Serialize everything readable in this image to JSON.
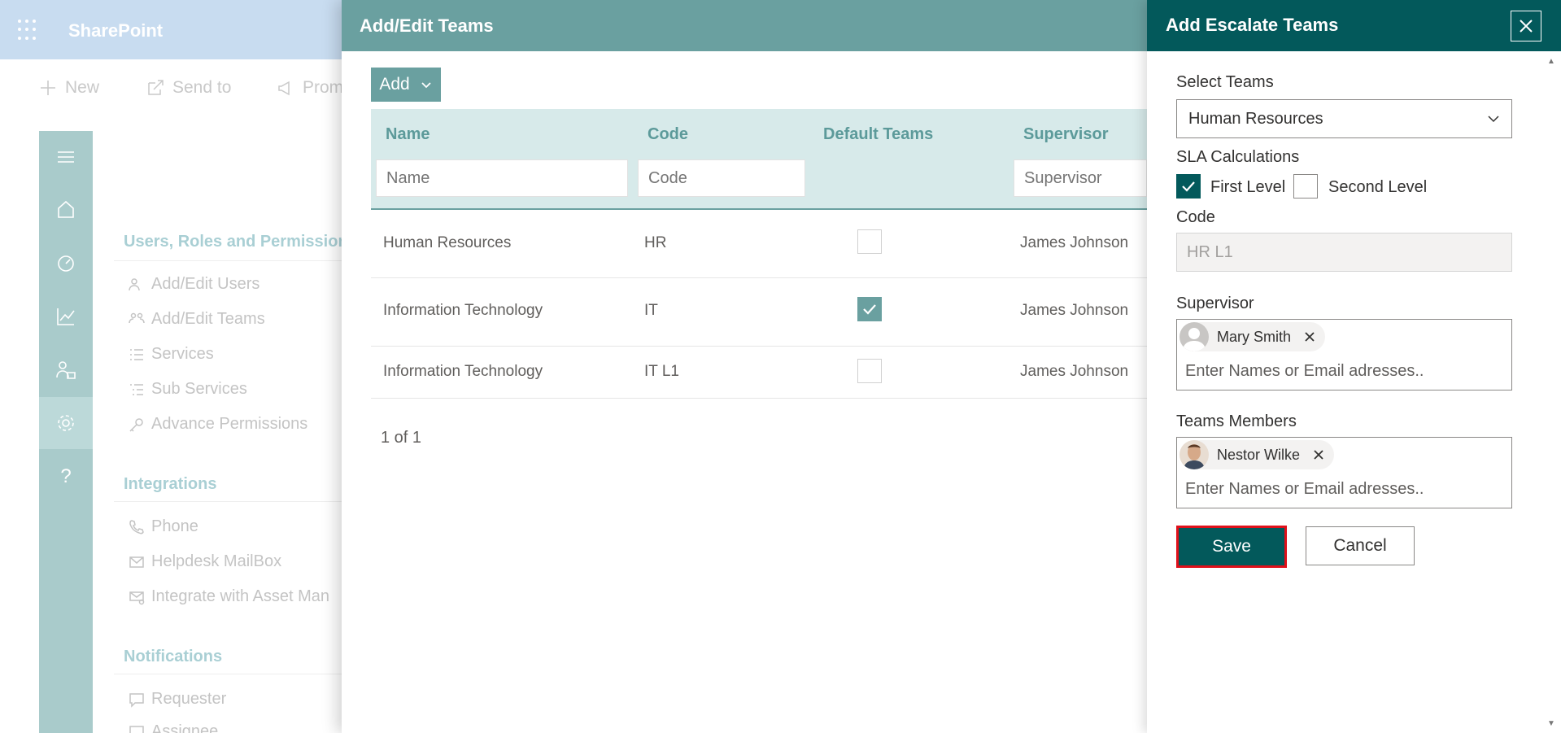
{
  "sharepoint": {
    "brand": "SharePoint",
    "commands": [
      {
        "label": "New",
        "icon": "plus-icon"
      },
      {
        "label": "Send to",
        "icon": "share-icon"
      },
      {
        "label": "Prom",
        "icon": "megaphone-icon"
      }
    ],
    "rail_icons": [
      "menu-icon",
      "home-icon",
      "dashboard-icon",
      "chart-icon",
      "people-icon",
      "gear-icon",
      "help-icon"
    ],
    "rail_help": "?",
    "nav": {
      "users_heading": "Users, Roles and Permissions",
      "users_items": [
        "Add/Edit Users",
        "Add/Edit Teams",
        "Services",
        "Sub Services",
        "Advance Permissions"
      ],
      "integrations_heading": "Integrations",
      "integrations_items": [
        "Phone",
        "Helpdesk MailBox",
        "Integrate with Asset Man"
      ],
      "notifications_heading": "Notifications",
      "notifications_items": [
        "Requester",
        "Assignee"
      ]
    }
  },
  "teams_panel": {
    "title": "Add/Edit Teams",
    "add_label": "Add",
    "columns": [
      "Name",
      "Code",
      "Default Teams",
      "Supervisor"
    ],
    "filters": {
      "name": "Name",
      "code": "Code",
      "supervisor": "Supervisor"
    },
    "rows": [
      {
        "name": "Human Resources",
        "code": "HR",
        "default": false,
        "supervisor": "James Johnson"
      },
      {
        "name": "Information Technology",
        "code": "IT",
        "default": true,
        "supervisor": "James Johnson"
      },
      {
        "name": "Information Technology",
        "code": "IT L1",
        "default": false,
        "supervisor": "James Johnson"
      }
    ],
    "pager": "1 of 1"
  },
  "escalate_panel": {
    "title": "Add Escalate Teams",
    "select_teams_label": "Select Teams",
    "select_teams_value": "Human Resources",
    "sla_label": "SLA Calculations",
    "first_level_label": "First Level",
    "first_level_checked": true,
    "second_level_label": "Second Level",
    "second_level_checked": false,
    "code_label": "Code",
    "code_value": "HR L1",
    "supervisor_label": "Supervisor",
    "supervisor_person": "Mary Smith",
    "supervisor_placeholder": "Enter Names or Email adresses..",
    "members_label": "Teams Members",
    "member_person": "Nestor Wilke",
    "members_placeholder": "Enter Names or Email adresses..",
    "save_label": "Save",
    "cancel_label": "Cancel"
  },
  "colors": {
    "brand_dark": "#03595b",
    "brand_mid": "#6aa0a0",
    "header_light": "#d7eaea",
    "save_outline": "#e0101a"
  }
}
